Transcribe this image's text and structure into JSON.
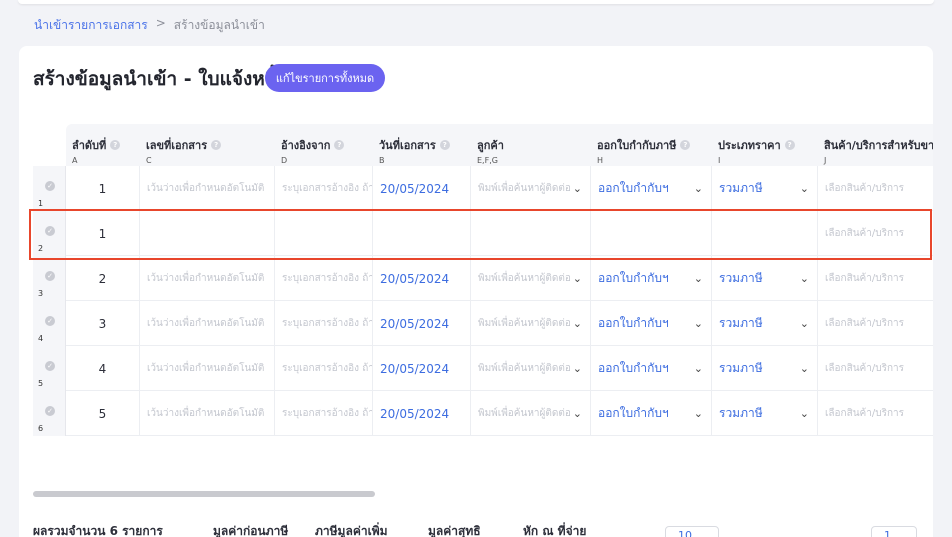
{
  "breadcrumb": {
    "parent": "นำเข้ารายการเอกสาร",
    "separator": ">",
    "current": "สร้างข้อมูลนำเข้า"
  },
  "page": {
    "title": "สร้างข้อมูลนำเข้า - ใบแจ้งหนี้",
    "edit_all_button": "แก้ไขรายการทั้งหมด"
  },
  "columns": [
    {
      "name": "ลำดับที่",
      "code": "A"
    },
    {
      "name": "เลขที่เอกสาร",
      "code": "C"
    },
    {
      "name": "อ้างอิงจาก",
      "code": "D"
    },
    {
      "name": "วันที่เอกสาร",
      "code": "B"
    },
    {
      "name": "ลูกค้า",
      "code": "E,F,G"
    },
    {
      "name": "ออกใบกำกับภาษี",
      "code": "H"
    },
    {
      "name": "ประเภทราคา",
      "code": "I"
    },
    {
      "name": "สินค้า/บริการสำหรับขาย",
      "code": "J"
    }
  ],
  "placeholders": {
    "doc_no": "เว้นว่างเพื่อกำหนดอัตโนมัติ",
    "reference": "ระบุเอกสารอ้างอิง ถ้ามี",
    "customer": "พิมพ์เพื่อค้นหาผู้ติดต่อ",
    "product": "เลือกสินค้า/บริการ"
  },
  "rows": [
    {
      "row": "1",
      "seq": "1",
      "date": "20/05/2024",
      "tax_invoice": "ออกใบกำกับฯ",
      "price_type": "รวมภาษี"
    },
    {
      "row": "2",
      "seq": "1",
      "date": "",
      "tax_invoice": "",
      "price_type": ""
    },
    {
      "row": "3",
      "seq": "2",
      "date": "20/05/2024",
      "tax_invoice": "ออกใบกำกับฯ",
      "price_type": "รวมภาษี"
    },
    {
      "row": "4",
      "seq": "3",
      "date": "20/05/2024",
      "tax_invoice": "ออกใบกำกับฯ",
      "price_type": "รวมภาษี"
    },
    {
      "row": "5",
      "seq": "4",
      "date": "20/05/2024",
      "tax_invoice": "ออกใบกำกับฯ",
      "price_type": "รวมภาษี"
    },
    {
      "row": "6",
      "seq": "5",
      "date": "20/05/2024",
      "tax_invoice": "ออกใบกำกับฯ",
      "price_type": "รวมภาษี"
    }
  ],
  "selected_row": "2",
  "footer": {
    "total": "ผลรวมจำนวน 6 รายการ",
    "pre_tax": "มูลค่าก่อนภาษี",
    "vat": "ภาษีมูลค่าเพิ่ม",
    "net": "มูลค่าสุทธิ",
    "withholding": "หัก ณ ที่จ่าย",
    "page_size": "10",
    "page_number": "1"
  },
  "colors": {
    "accent": "#6b63f0",
    "link": "#3d6de0",
    "selection": "#e8462c"
  }
}
